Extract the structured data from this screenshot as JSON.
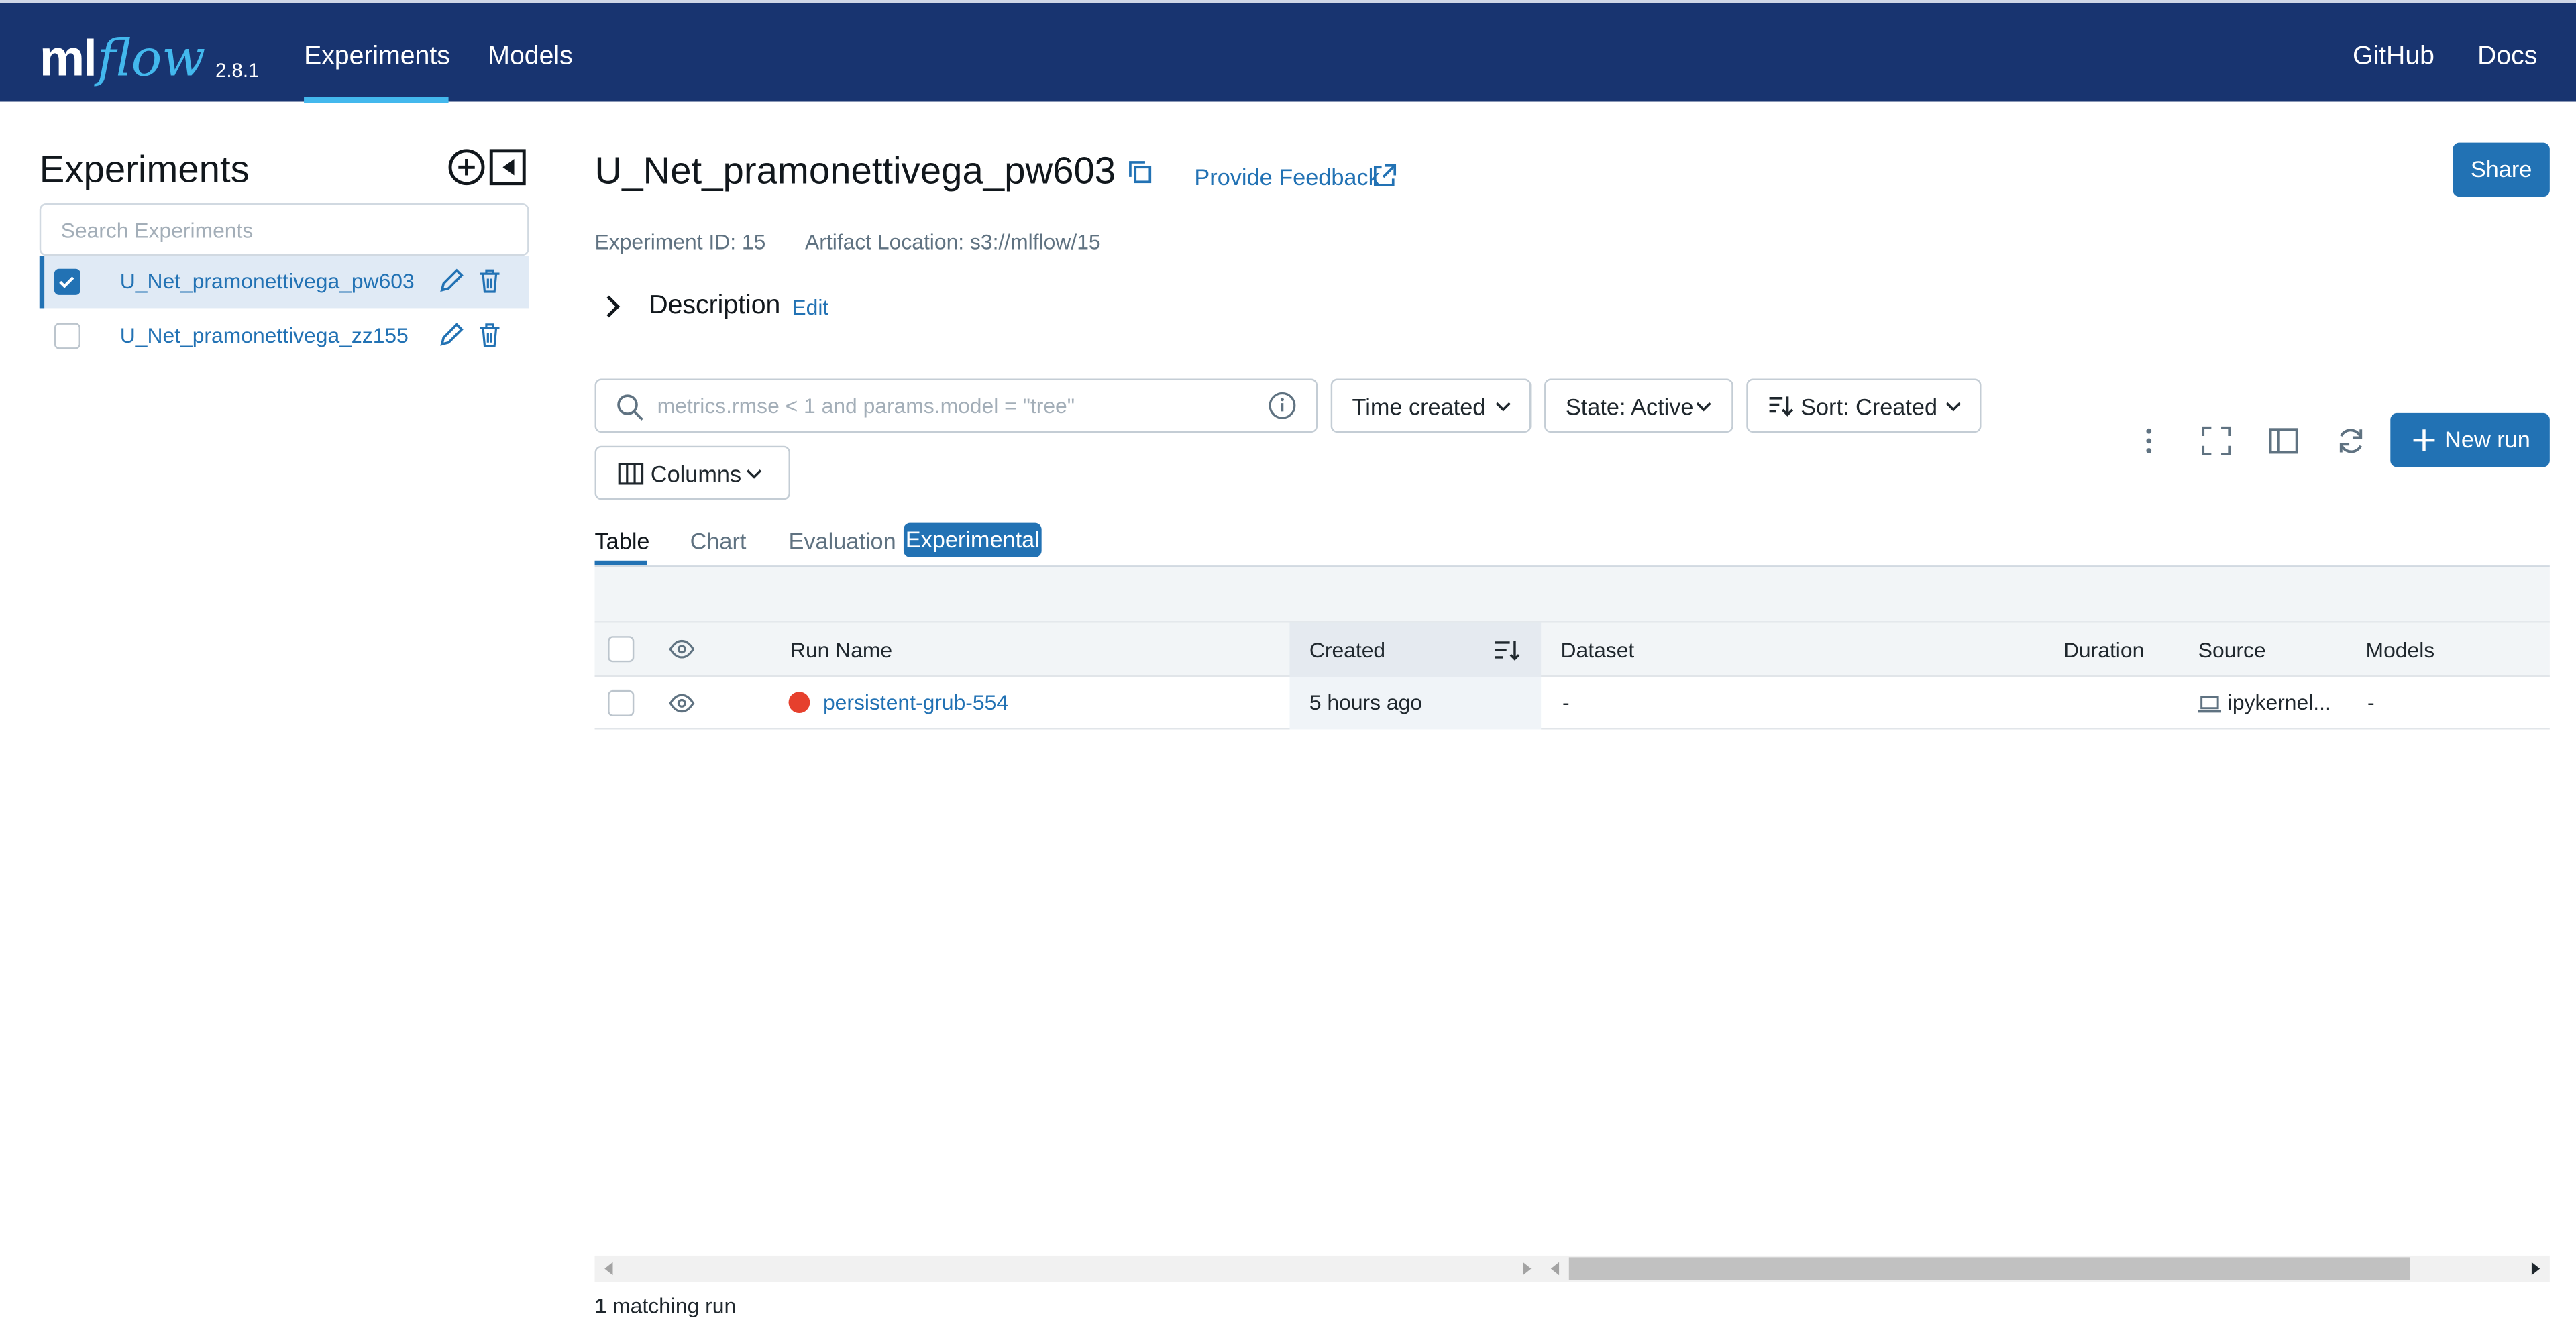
{
  "header": {
    "logo_ml": "ml",
    "logo_flow": "flow",
    "version": "2.8.1",
    "nav": [
      {
        "label": "Experiments"
      },
      {
        "label": "Models"
      }
    ],
    "right_links": [
      {
        "label": "GitHub"
      },
      {
        "label": "Docs"
      }
    ]
  },
  "sidebar": {
    "title": "Experiments",
    "search_placeholder": "Search Experiments",
    "experiments": [
      {
        "name": "U_Net_pramonettivega_pw603",
        "checked": true
      },
      {
        "name": "U_Net_pramonettivega_zz155",
        "checked": false
      }
    ]
  },
  "experiment": {
    "title": "U_Net_pramonettivega_pw603",
    "feedback": "Provide Feedback",
    "share": "Share",
    "id_text": "Experiment ID: 15",
    "artifact_text": "Artifact Location: s3://mlflow/15",
    "description_label": "Description",
    "description_edit": "Edit"
  },
  "filters": {
    "search_placeholder": "metrics.rmse < 1 and params.model = \"tree\"",
    "time": "Time created",
    "state": "State: Active",
    "sort": "Sort: Created",
    "columns": "Columns",
    "new_run": "New run"
  },
  "tabs": [
    {
      "label": "Table",
      "active": true
    },
    {
      "label": "Chart",
      "active": false
    },
    {
      "label": "Evaluation",
      "active": false
    }
  ],
  "experimental_badge": "Experimental",
  "table": {
    "headers": {
      "run_name": "Run Name",
      "created": "Created",
      "dataset": "Dataset",
      "duration": "Duration",
      "source": "Source",
      "models": "Models"
    },
    "rows": [
      {
        "run_name": "persistent-grub-554",
        "status_color": "#e6402d",
        "created": "5 hours ago",
        "dataset": "-",
        "duration": "",
        "source": "ipykernel...",
        "models": "-"
      }
    ]
  },
  "footer": {
    "count": "1",
    "count_suffix": "matching run"
  },
  "colors": {
    "navbar": "#183470",
    "accent": "#2272b4",
    "logo_flow": "#43b8ed"
  }
}
